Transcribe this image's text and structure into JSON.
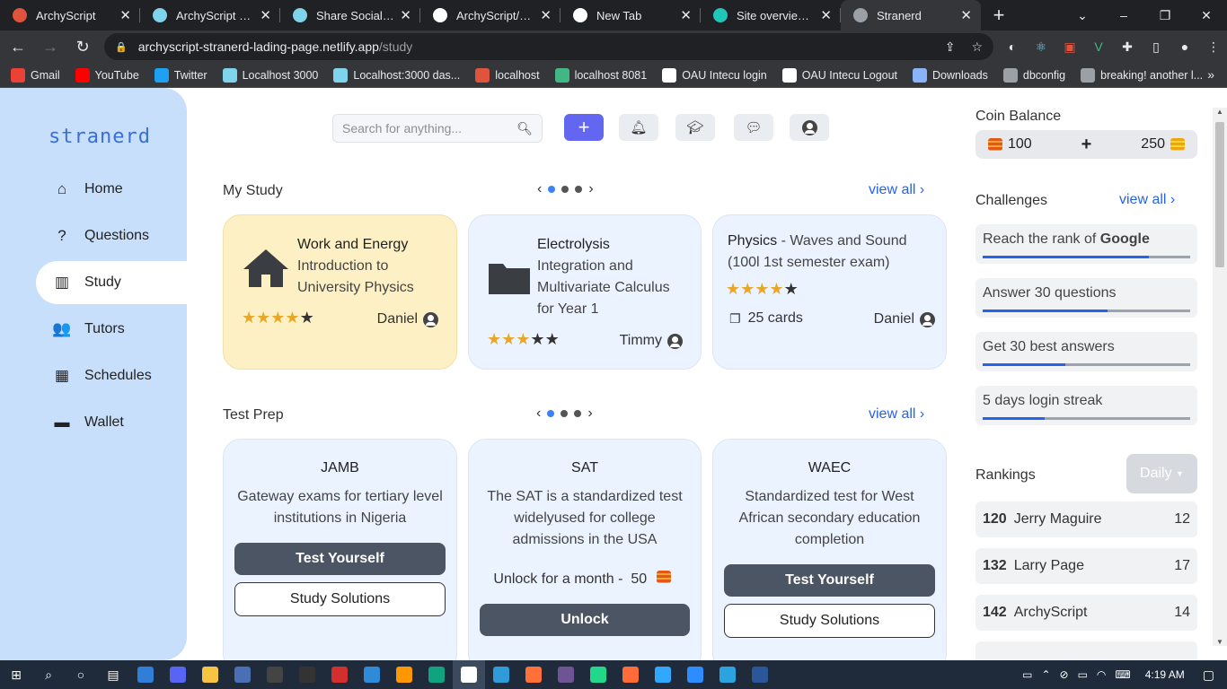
{
  "browser": {
    "tabs": [
      {
        "label": "ArchyScript",
        "icon": "user-avatar-icon",
        "color": "#e0533d"
      },
      {
        "label": "ArchyScript Portfolio",
        "icon": "react-icon",
        "color": "#7fd3ea"
      },
      {
        "label": "Share Social - Se",
        "icon": "react-icon",
        "color": "#7fd3ea"
      },
      {
        "label": "ArchyScript/stran",
        "icon": "github-icon",
        "color": "#ffffff"
      },
      {
        "label": "New Tab",
        "icon": "chrome-icon",
        "color": "#ffffff"
      },
      {
        "label": "Site overview | ar",
        "icon": "netlify-icon",
        "color": "#20c6b7"
      },
      {
        "label": "Stranerd",
        "icon": "globe-icon",
        "color": "#9aa0a6"
      }
    ],
    "url_host": "archyscript-stranerd-lading-page.netlify.app",
    "url_path": "/study",
    "bookmarks": [
      {
        "label": "Gmail",
        "icon": "gmail-icon",
        "color": "#ea4335"
      },
      {
        "label": "YouTube",
        "icon": "youtube-icon",
        "color": "#ff0000"
      },
      {
        "label": "Twitter",
        "icon": "twitter-icon",
        "color": "#1da1f2"
      },
      {
        "label": "Localhost 3000",
        "icon": "react-icon",
        "color": "#7fd3ea"
      },
      {
        "label": "Localhost:3000 das...",
        "icon": "react-icon",
        "color": "#7fd3ea"
      },
      {
        "label": "localhost",
        "icon": "user-avatar-icon",
        "color": "#e0533d"
      },
      {
        "label": "localhost 8081",
        "icon": "vue-icon",
        "color": "#41b883"
      },
      {
        "label": "OAU Intecu login",
        "icon": "home-icon",
        "color": "#ffffff"
      },
      {
        "label": "OAU Intecu Logout",
        "icon": "home-icon",
        "color": "#ffffff"
      },
      {
        "label": "Downloads",
        "icon": "download-icon",
        "color": "#8ab4f8"
      },
      {
        "label": "dbconfig",
        "icon": "braces-icon",
        "color": "#9aa0a6"
      },
      {
        "label": "breaking! another l...",
        "icon": "globe-icon",
        "color": "#9aa0a6"
      }
    ]
  },
  "app": {
    "logo": "stranerd",
    "nav": [
      {
        "label": "Home",
        "icon": "home-icon",
        "glyph": "⌂"
      },
      {
        "label": "Questions",
        "icon": "question-icon",
        "glyph": "?"
      },
      {
        "label": "Study",
        "icon": "chart-icon",
        "glyph": "▥"
      },
      {
        "label": "Tutors",
        "icon": "users-icon",
        "glyph": "👥"
      },
      {
        "label": "Schedules",
        "icon": "calendar-icon",
        "glyph": "▦"
      },
      {
        "label": "Wallet",
        "icon": "wallet-icon",
        "glyph": "▬"
      }
    ],
    "search_placeholder": "Search for anything...",
    "my_study": {
      "title": "My Study",
      "view_all": "view all",
      "cards": [
        {
          "title": "Work and Energy",
          "subtitle": "Introduction to University Physics",
          "author": "Daniel",
          "rating": 4,
          "icon": "house-icon"
        },
        {
          "title": "Electrolysis",
          "subtitle": "Integration and Multivariate Calculus for Year 1",
          "author": "Timmy",
          "rating": 3,
          "icon": "folder-icon"
        },
        {
          "title": "Physics",
          "separator": " - ",
          "subtitle": "Waves and Sound (100l 1st semester exam)",
          "cards": "25 cards",
          "author": "Daniel",
          "rating": 4
        }
      ]
    },
    "test_prep": {
      "title": "Test Prep",
      "view_all": "view all",
      "cards": [
        {
          "title": "JAMB",
          "desc": "Gateway exams for tertiary level institutions in Nigeria",
          "primary": "Test Yourself",
          "secondary": "Study Solutions"
        },
        {
          "title": "SAT",
          "desc": "The SAT is a standardized test widelyused for college admissions in the USA",
          "unlock_text": "Unlock for a month -",
          "unlock_price": "50",
          "primary": "Unlock"
        },
        {
          "title": "WAEC",
          "desc": "Standardized test for West African secondary education completion",
          "primary": "Test Yourself",
          "secondary": "Study Solutions"
        }
      ]
    },
    "coin": {
      "title": "Coin Balance",
      "bronze": "100",
      "gold": "250"
    },
    "challenges": {
      "title": "Challenges",
      "view_all": "view all",
      "items": [
        {
          "text": "Reach the rank of",
          "strong": "Google",
          "progress": 0.8
        },
        {
          "text": "Answer 30 questions",
          "progress": 0.6
        },
        {
          "text": "Get 30 best answers",
          "progress": 0.4
        },
        {
          "text": "5 days login streak",
          "progress": 0.3
        }
      ]
    },
    "rankings": {
      "title": "Rankings",
      "period": "Daily",
      "items": [
        {
          "rank": "120",
          "name": "Jerry Maguire",
          "score": "12"
        },
        {
          "rank": "132",
          "name": "Larry Page",
          "score": "17"
        },
        {
          "rank": "142",
          "name": "ArchyScript",
          "score": "14"
        }
      ]
    }
  },
  "taskbar": {
    "time": "4:19 AM",
    "apps": [
      "windows-start-icon",
      "search-icon",
      "cortana-icon",
      "task-view-icon",
      "virtualbox-icon",
      "discord-icon",
      "file-explorer-icon",
      "r-studio-icon",
      "terminal-icon",
      "calculator-icon",
      "acrobat-icon",
      "vscode-icon",
      "sublime-icon",
      "chatgpt-icon",
      "chrome-icon",
      "edge-icon",
      "firefox-icon",
      "github-desktop-icon",
      "pycharm-icon",
      "postman-icon",
      "photoshop-icon",
      "zoom-icon",
      "telegram-icon",
      "word-icon"
    ]
  }
}
